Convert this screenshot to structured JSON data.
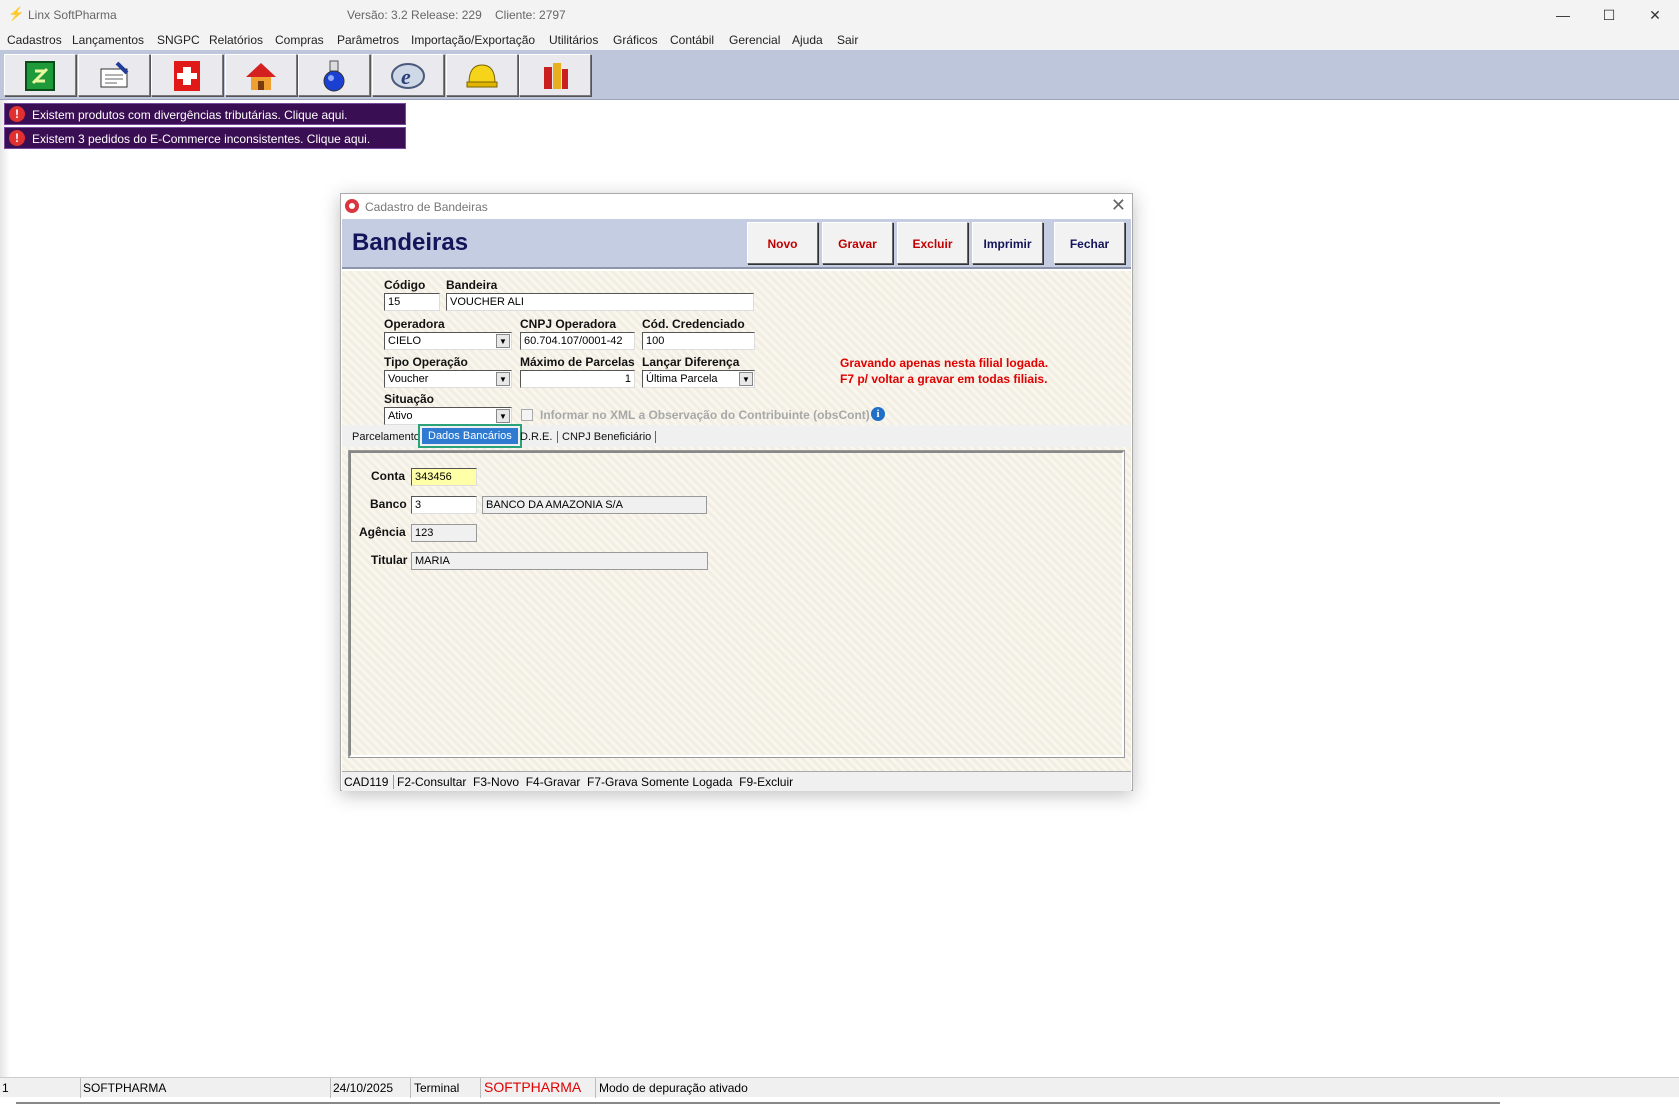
{
  "app": {
    "title": "Linx SoftPharma",
    "version": "Versão: 3.2 Release: 229",
    "client": "Cliente: 2797",
    "window_buttons": [
      "—",
      "☐",
      "✕"
    ]
  },
  "menu": [
    "Cadastros",
    "Lançamentos",
    "SNGPC",
    "Relatórios",
    "Compras",
    "Parâmetros",
    "Importação/Exportação",
    "Utilitários",
    "Gráficos",
    "Contábil",
    "Gerencial",
    "Ajuda",
    "Sair"
  ],
  "toolbar": {
    "buttons": [
      "cash-register-icon",
      "edit-document-icon",
      "pharmacy-cross-icon",
      "house-icon",
      "flask-icon",
      "nfe-icon",
      "helmet-icon",
      "books-icon"
    ]
  },
  "alerts": [
    "Existem produtos com divergências tributárias. Clique aqui.",
    "Existem 3 pedidos do E-Commerce inconsistentes. Clique aqui."
  ],
  "dialog": {
    "title": "Cadastro de Bandeiras",
    "heading": "Bandeiras",
    "buttons": {
      "novo": "Novo",
      "gravar": "Gravar",
      "excluir": "Excluir",
      "imprimir": "Imprimir",
      "fechar": "Fechar"
    },
    "form": {
      "codigo_label": "Código",
      "codigo": "15",
      "bandeira_label": "Bandeira",
      "bandeira": "VOUCHER ALI",
      "operadora_label": "Operadora",
      "operadora": "CIELO",
      "cnpj_label": "CNPJ Operadora",
      "cnpj": "60.704.107/0001-42",
      "credenciado_label": "Cód. Credenciado",
      "credenciado": "100",
      "tipo_label": "Tipo Operação",
      "tipo": "Voucher",
      "max_parcelas_label": "Máximo de Parcelas",
      "max_parcelas": "1",
      "lancar_label": "Lançar Diferença",
      "lancar": "Última Parcela",
      "situacao_label": "Situação",
      "situacao": "Ativo",
      "xml_obs_label": "Informar no XML a Observação do Contribuinte (obsCont)",
      "warning_line1": "Gravando apenas nesta filial logada.",
      "warning_line2": "F7 p/ voltar a gravar em todas filiais."
    },
    "tabs": [
      "Parcelamento",
      "Dados Bancários",
      "D.R.E.",
      "CNPJ Beneficiário"
    ],
    "bank": {
      "conta_label": "Conta",
      "conta": "343456",
      "banco_label": "Banco",
      "banco_code": "3",
      "banco_name": "BANCO DA AMAZONIA S/A",
      "agencia_label": "Agência",
      "agencia": "123",
      "titular_label": "Titular",
      "titular": "MARIA"
    },
    "status": {
      "screen": "CAD119",
      "shortcuts": "F2-Consultar  F3-Novo  F4-Gravar  F7-Grava Somente Logada  F9-Excluir"
    }
  },
  "statusbar": {
    "num": "1",
    "user": "SOFTPHARMA",
    "date": "24/10/2025",
    "terminal": "Terminal",
    "brand": "SOFTPHARMA",
    "mode": "Modo de depuração ativado"
  }
}
